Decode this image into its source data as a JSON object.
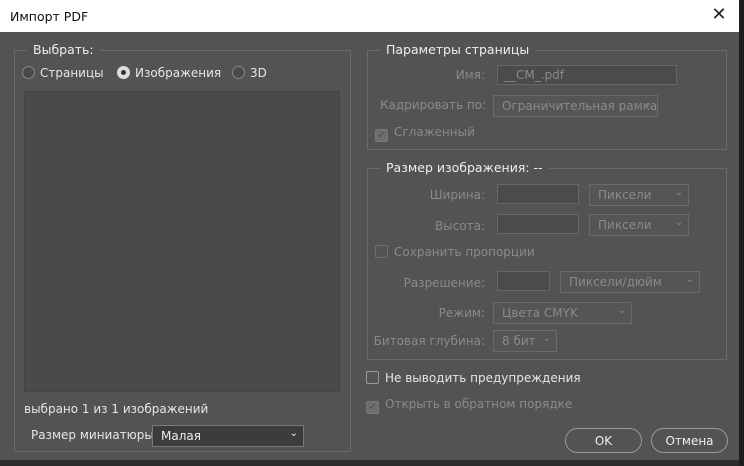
{
  "window": {
    "title": "Импорт PDF",
    "close": "✕"
  },
  "select_group": {
    "legend": "Выбрать:",
    "options": [
      {
        "label": "Страницы",
        "selected": false
      },
      {
        "label": "Изображения",
        "selected": true
      },
      {
        "label": "3D",
        "selected": false
      }
    ],
    "status": "выбрано 1 из 1 изображений",
    "thumb_label": "Размер миниатюры:",
    "thumb_value": "Малая"
  },
  "page_options": {
    "legend": "Параметры страницы",
    "name_label": "Имя:",
    "name_value": "__CM_.pdf",
    "crop_label": "Кадрировать по:",
    "crop_value": "Ограничительная рамка",
    "antialias_label": "Сглаженный",
    "antialias_checked": true
  },
  "image_size": {
    "legend": "Размер изображения: --",
    "width_label": "Ширина:",
    "width_value": "",
    "width_unit": "Пиксели",
    "height_label": "Высота:",
    "height_value": "",
    "height_unit": "Пиксели",
    "constrain_label": "Сохранить пропорции",
    "resolution_label": "Разрешение:",
    "resolution_value": "",
    "resolution_unit": "Пиксели/дюйм",
    "mode_label": "Режим:",
    "mode_value": "Цвета CMYK",
    "depth_label": "Битовая глубина:",
    "depth_value": "8 бит"
  },
  "options": {
    "suppress_label": "Не выводить предупреждения",
    "suppress_checked": false,
    "reverse_label": "Открыть в обратном порядке",
    "reverse_checked": true
  },
  "buttons": {
    "ok": "OK",
    "cancel": "Отмена"
  }
}
